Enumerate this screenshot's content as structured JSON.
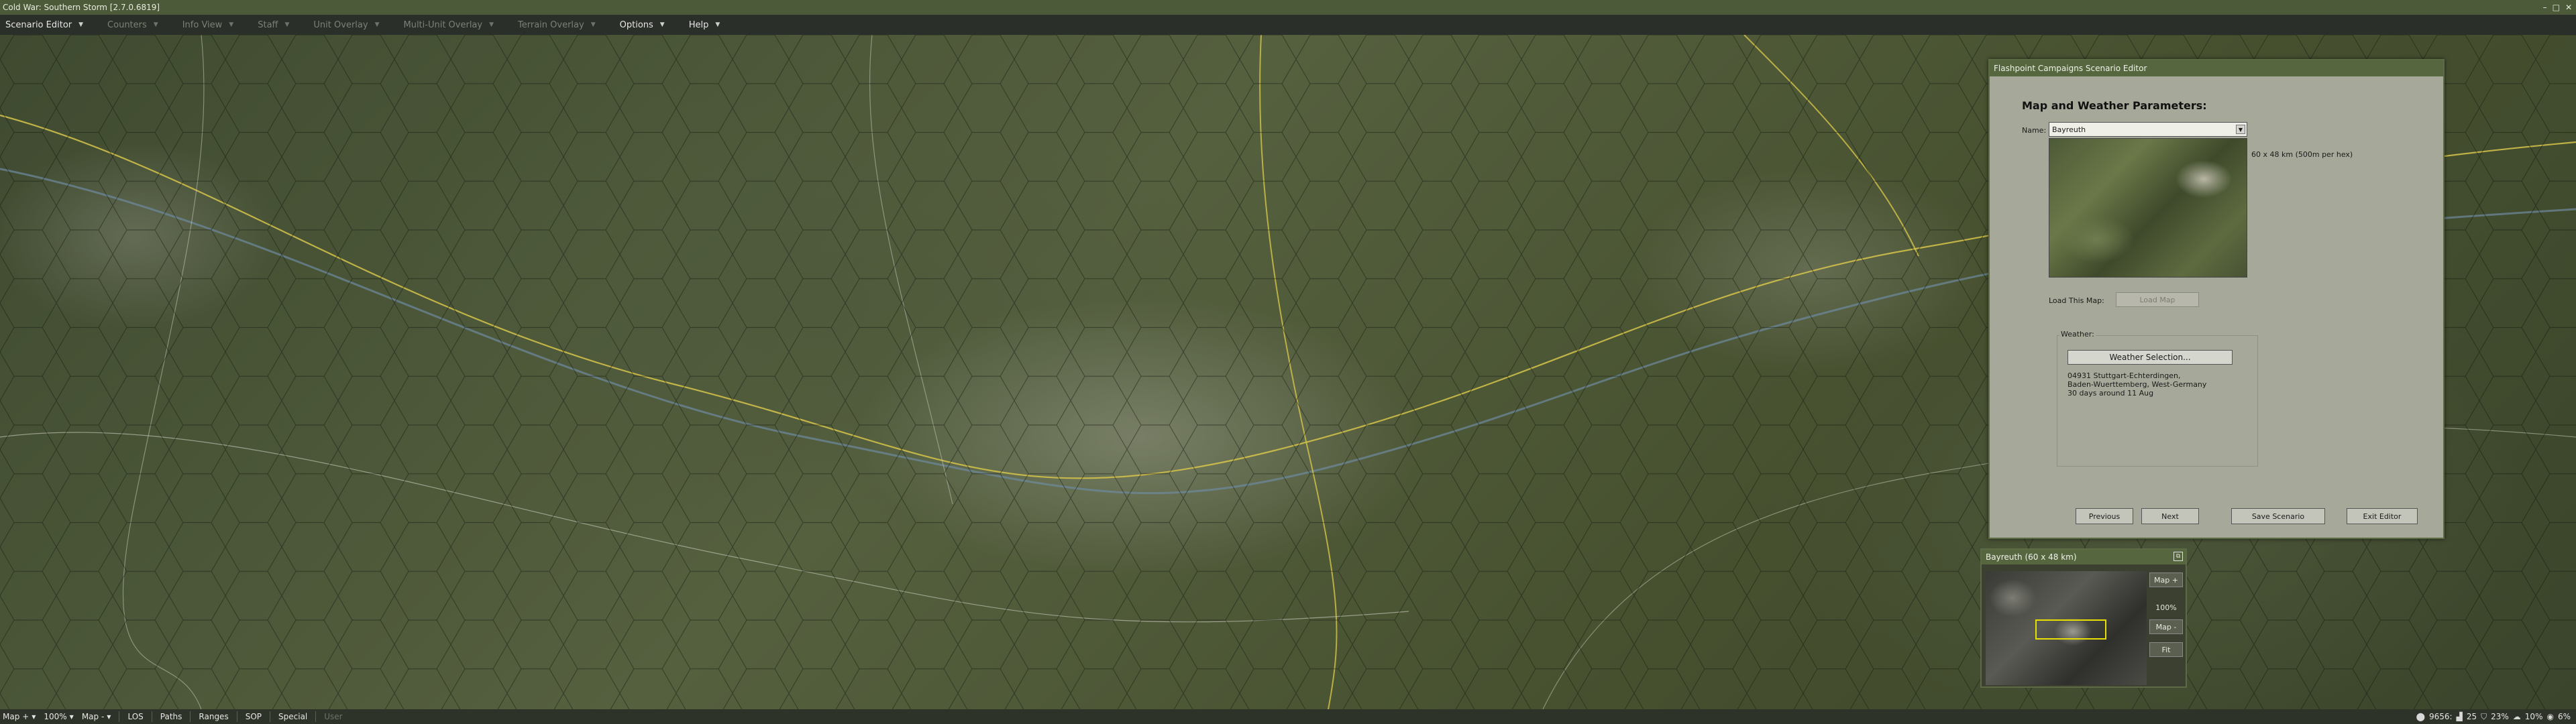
{
  "window": {
    "title": "Cold War: Southern Storm  [2.7.0.6819]",
    "min": "–",
    "max": "□",
    "close": "✕"
  },
  "menubar": {
    "items": [
      {
        "label": "Scenario Editor",
        "enabled": true
      },
      {
        "label": "Counters",
        "enabled": false
      },
      {
        "label": "Info View",
        "enabled": false
      },
      {
        "label": "Staff",
        "enabled": false
      },
      {
        "label": "Unit Overlay",
        "enabled": false
      },
      {
        "label": "Multi-Unit Overlay",
        "enabled": false
      },
      {
        "label": "Terrain Overlay",
        "enabled": false
      },
      {
        "label": "Options",
        "enabled": true
      },
      {
        "label": "Help",
        "enabled": true
      }
    ]
  },
  "editor": {
    "title": "Flashpoint Campaigns Scenario Editor",
    "heading": "Map and Weather Parameters:",
    "name_label": "Name:",
    "name_value": "Bayreuth",
    "map_size": "60 x 48 km (500m per hex)",
    "load_label": "Load This Map:",
    "load_button": "Load Map",
    "weather_label": "Weather:",
    "weather_button": "Weather Selection...",
    "weather_line1": "04931 Stuttgart-Echterdingen,",
    "weather_line2": "Baden-Wuerttemberg, West-Germany",
    "weather_line3": "30 days around 11 Aug",
    "buttons": {
      "previous": "Previous",
      "next": "Next",
      "save": "Save Scenario",
      "exit": "Exit Editor"
    }
  },
  "minimap": {
    "title": "Bayreuth (60 x 48 km)",
    "map_plus": "Map +",
    "zoom": "100%",
    "map_minus": "Map -",
    "fit": "Fit"
  },
  "statusbar": {
    "map_plus": "Map +",
    "zoom": "100%",
    "map_minus": "Map -",
    "los": "LOS",
    "paths": "Paths",
    "ranges": "Ranges",
    "sop": "SOP",
    "special": "Special",
    "user": "User",
    "readiness": "9656:",
    "mode": "25",
    "fatigue": "23%",
    "weather_pct": "10%",
    "vis": "6%"
  },
  "colors": {
    "header_green": "#56673f",
    "dialog_bg": "#a6a899",
    "viewport_yellow": "#e8e000"
  }
}
